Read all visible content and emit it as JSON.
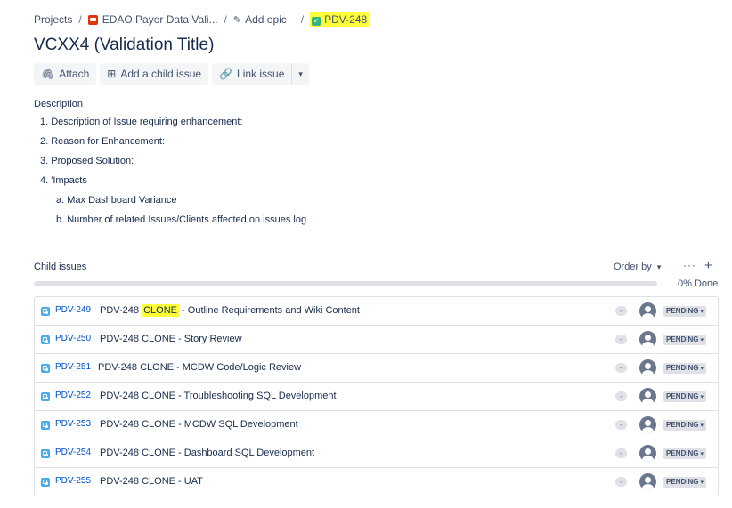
{
  "breadcrumb": {
    "projects": "Projects",
    "project_name": "EDAO Payor Data Vali...",
    "epic_label": "Add epic",
    "issue_key": "PDV-248",
    "separator": "/",
    "project_icon": "project-icon",
    "colors": {
      "highlight": "#ffff3a",
      "project_icon": "#de350b",
      "check_icon": "#36b37e"
    }
  },
  "title": "VCXX4 (Validation Title)",
  "toolbar": {
    "attach": "Attach",
    "add_child": "Add a child issue",
    "link_issue": "Link issue"
  },
  "description": {
    "label": "Description",
    "items": [
      "1. Description of Issue requiring enhancement:",
      "2. Reason for Enhancement:",
      "3. Proposed Solution:",
      "4. 'Impacts"
    ],
    "subitems": [
      "a. Max Dashboard Variance",
      "b. Number of related Issues/Clients affected on issues log"
    ]
  },
  "child_issues": {
    "label": "Child issues",
    "order_by": "Order by",
    "more": "···",
    "add": "+",
    "progress_text": "0% Done",
    "progress_fraction": 0,
    "items": [
      {
        "key": "PDV-249",
        "prefix": "PDV-248",
        "highlight": "CLONE",
        "rest": " - Outline Requirements and Wiki Content",
        "priority": "-",
        "status": "PENDING"
      },
      {
        "key": "PDV-250",
        "summary": "PDV-248 CLONE - Story Review",
        "priority": "-",
        "status": "PENDING"
      },
      {
        "key": "PDV-251",
        "summary": "PDV-248 CLONE - MCDW Code/Logic Review",
        "priority": "-",
        "status": "PENDING"
      },
      {
        "key": "PDV-252",
        "summary": "PDV-248 CLONE - Troubleshooting SQL Development",
        "priority": "-",
        "status": "PENDING"
      },
      {
        "key": "PDV-253",
        "summary": "PDV-248 CLONE - MCDW SQL Development",
        "priority": "-",
        "status": "PENDING"
      },
      {
        "key": "PDV-254",
        "summary": "PDV-248 CLONE - Dashboard SQL Development",
        "priority": "-",
        "status": "PENDING"
      },
      {
        "key": "PDV-255",
        "summary": "PDV-248 CLONE - UAT",
        "priority": "-",
        "status": "PENDING"
      }
    ]
  }
}
